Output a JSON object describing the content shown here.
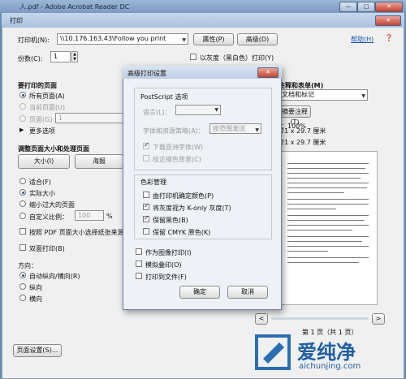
{
  "window": {
    "title": "人.pdf - Adobe Acrobat Reader DC",
    "controls": [
      "—",
      "□",
      "✕"
    ]
  },
  "print_dialog": {
    "title": "打印",
    "close": "✕",
    "printer_label": "打印机(N):",
    "printer_value": "\\\\10.176.163.43\\Follow you print",
    "properties_button": "属性(P)",
    "advanced_button": "高级(D)",
    "help_link": "帮助(H)",
    "copies_label": "份数(C):",
    "copies_value": "1",
    "grayscale_label": "以灰度（黑白色）打印(Y)",
    "pages_section": "要打印的页面",
    "all_pages": "所有页面(A)",
    "current_page": "当前页面(U)",
    "pages_option": "页面(G)",
    "pages_value": "1",
    "more_options": "更多选项",
    "sizing_section": "调整页面大小和处理页面",
    "size_button": "大小(I)",
    "poster_button": "海报",
    "fit": "适合(F)",
    "actual_size": "实际大小",
    "shrink_oversized": "缩小过大的页面",
    "custom_scale": "自定义比例：",
    "custom_scale_value": "100",
    "percent": "%",
    "paper_source_label": "按照 PDF 页面大小选择纸张来源(Z)",
    "duplex_label": "双面打印(B)",
    "orientation_label": "方向：",
    "auto_orientation": "自动纵向/横向(R)",
    "portrait": "纵向",
    "landscape": "横向",
    "page_setup_button": "页面设置(S)...",
    "annotations_title": "注释和表单(M)",
    "annotations_value": "文档和标记",
    "summarize_button": "摘要注释(T)",
    "scale_text": "比例：100%",
    "size_text_1": "21 x 29.7 厘米",
    "size_text_2": "21 x 29.7 厘米",
    "preview_prev": "<",
    "preview_next": ">",
    "page_indicator": "第 1 页（共 1 页）"
  },
  "advanced_dialog": {
    "title": "高级打印设置",
    "close": "✕",
    "postscript_section": "PostScript 选项",
    "terms_label": "语言(L)：",
    "terms_value": "",
    "font_download_label": "字体和资源策略(A)：",
    "font_download_value": "按范围发送",
    "download_asian_fonts": "下载亚洲字体(W)",
    "emit_undercolor": "校正褪色背景(C)",
    "color_section": "色彩管理",
    "printer_determines_color": "由打印机确定颜色(P)",
    "treat_gray_as_k": "将灰度视为 K-only 灰度(T)",
    "preserve_black": "保留黑色(B)",
    "preserve_cmyk": "保留 CMYK 原色(K)",
    "print_as_image": "作为图像打印(I)",
    "simulate_overprint": "模拟叠印(O)",
    "print_to_file": "打印到文件(F)",
    "ok_button": "确定",
    "cancel_button": "取消"
  },
  "watermark": {
    "logo_text": "爱纯净",
    "url": "aichunjing.com"
  }
}
